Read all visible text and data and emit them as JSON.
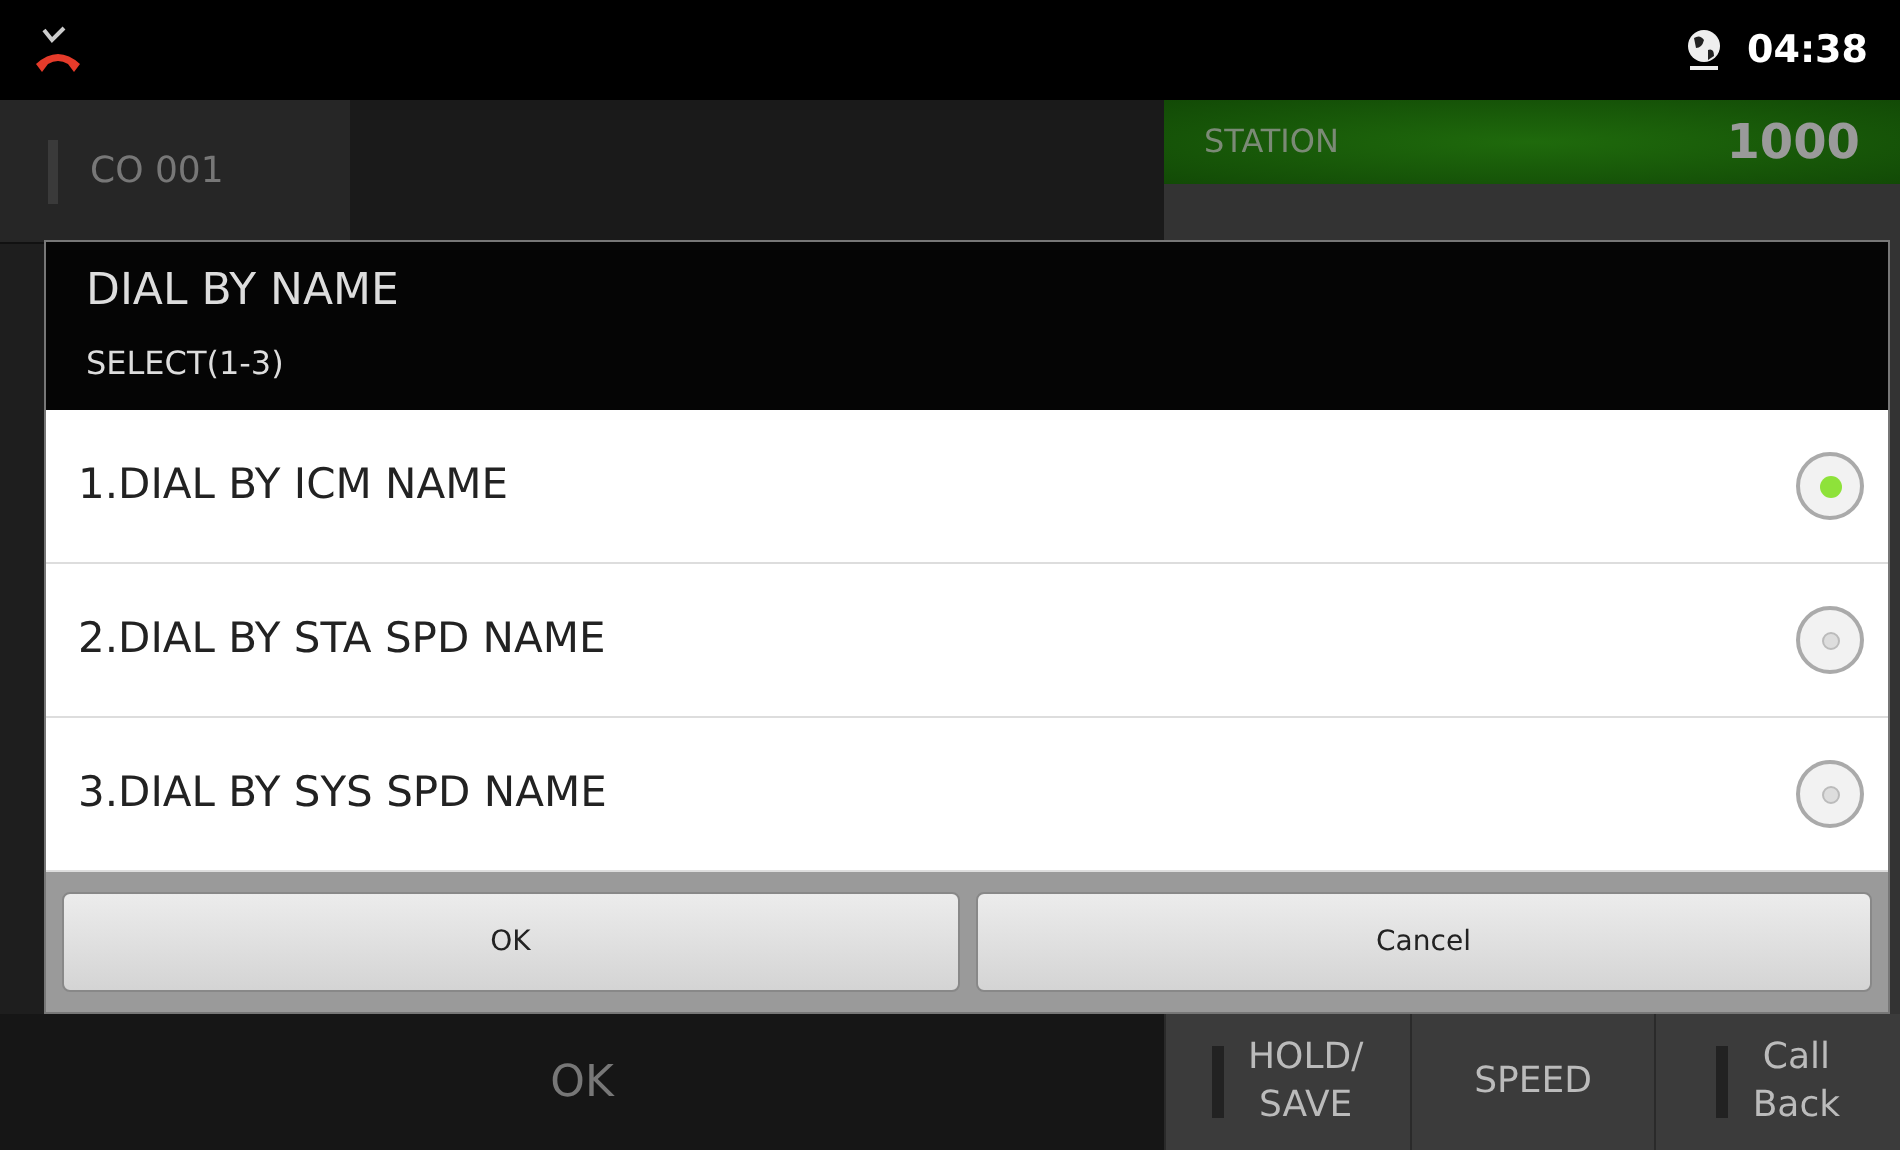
{
  "status_bar": {
    "time": "04:38"
  },
  "line_keys": [
    {
      "label": "CO 001"
    }
  ],
  "station": {
    "label": "STATION",
    "number": "1000"
  },
  "bottom_bar": {
    "ok_label": "OK",
    "keys": [
      {
        "label": "HOLD/\nSAVE",
        "lamp": true
      },
      {
        "label": "SPEED",
        "lamp": false
      },
      {
        "label": "Call\nBack",
        "lamp": true
      }
    ]
  },
  "dialog": {
    "title": "DIAL BY NAME",
    "subtitle": "SELECT(1-3)",
    "options": [
      {
        "label": "1.DIAL BY ICM NAME",
        "selected": true
      },
      {
        "label": "2.DIAL BY STA SPD NAME",
        "selected": false
      },
      {
        "label": "3.DIAL BY SYS SPD NAME",
        "selected": false
      }
    ],
    "buttons": [
      "OK",
      "Cancel"
    ]
  }
}
